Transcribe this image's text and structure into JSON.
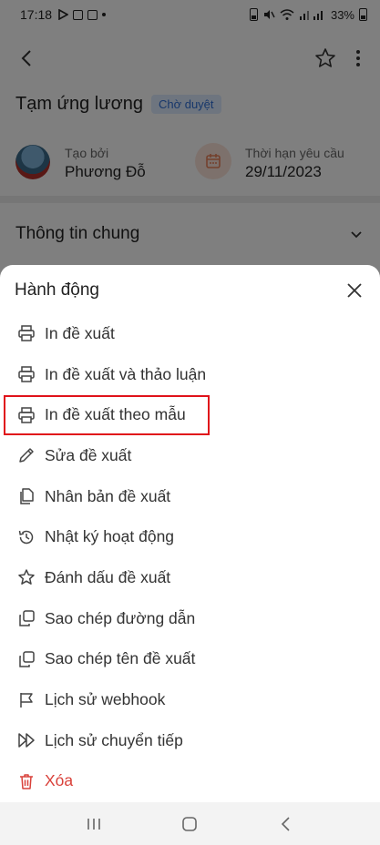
{
  "status_bar": {
    "time": "17:18",
    "battery": "33%"
  },
  "detail": {
    "title": "Tạm ứng lương",
    "status_badge": "Chờ duyệt",
    "created_by_label": "Tạo bởi",
    "created_by": "Phương Đỗ",
    "deadline_label": "Thời hạn yêu cầu",
    "deadline": "29/11/2023",
    "section_title": "Thông tin chung"
  },
  "sheet": {
    "title": "Hành động",
    "items": [
      {
        "label": "In đề xuất",
        "icon": "printer-icon"
      },
      {
        "label": "In đề xuất và thảo luận",
        "icon": "printer-icon"
      },
      {
        "label": "In đề xuất theo mẫu",
        "icon": "printer-icon"
      },
      {
        "label": "Sửa đề xuất",
        "icon": "pencil-icon"
      },
      {
        "label": "Nhân bản đề xuất",
        "icon": "copy-file-icon"
      },
      {
        "label": "Nhật ký hoạt động",
        "icon": "history-icon"
      },
      {
        "label": "Đánh dấu đề xuất",
        "icon": "star-icon"
      },
      {
        "label": "Sao chép đường dẫn",
        "icon": "copy-icon"
      },
      {
        "label": "Sao chép tên đề xuất",
        "icon": "copy-icon"
      },
      {
        "label": "Lịch sử webhook",
        "icon": "flag-icon"
      },
      {
        "label": "Lịch sử chuyển tiếp",
        "icon": "forward-icon"
      },
      {
        "label": "Xóa",
        "icon": "trash-icon"
      }
    ]
  },
  "colors": {
    "accent": "#2f6fd6",
    "danger": "#d9413a",
    "highlight": "#e0121a",
    "badge_bg": "#dceafe"
  }
}
